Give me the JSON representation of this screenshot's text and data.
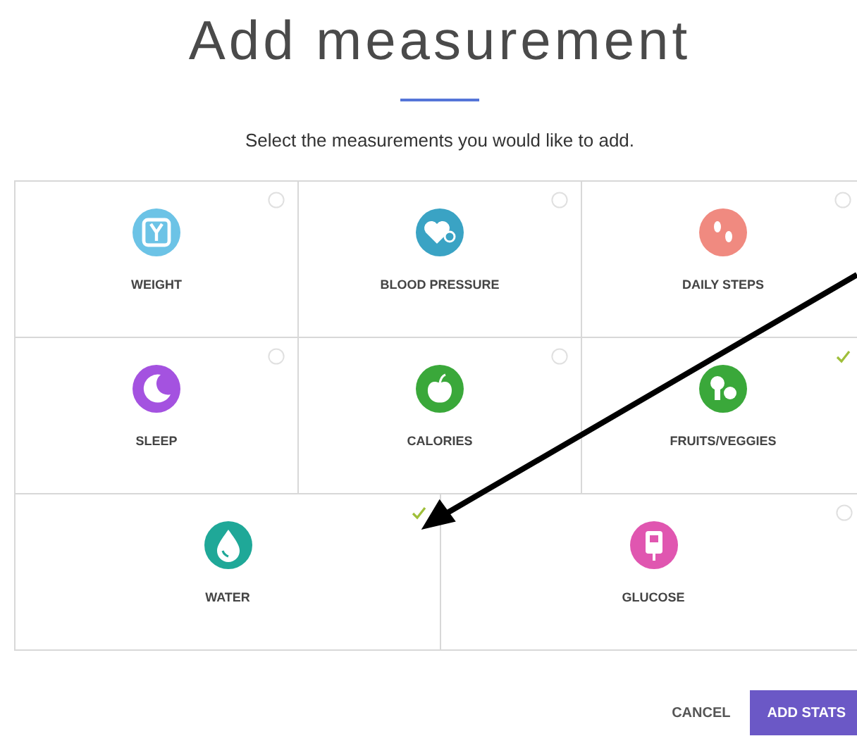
{
  "title": "Add measurement",
  "subtitle": "Select the measurements you would like to add.",
  "rows": [
    [
      {
        "label": "WEIGHT",
        "kind": "scale",
        "color": "#6cc3e6",
        "checked": false
      },
      {
        "label": "BLOOD PRESSURE",
        "kind": "heart",
        "color": "#3aa3c4",
        "checked": false
      },
      {
        "label": "DAILY STEPS",
        "kind": "steps",
        "color": "#f08a80",
        "checked": false
      }
    ],
    [
      {
        "label": "SLEEP",
        "kind": "moon",
        "color": "#a452e0",
        "checked": false
      },
      {
        "label": "CALORIES",
        "kind": "apple",
        "color": "#3aa83a",
        "checked": false
      },
      {
        "label": "FRUITS/VEGGIES",
        "kind": "broccoli",
        "color": "#3aa83a",
        "checked": true
      }
    ],
    [
      {
        "label": "WATER",
        "kind": "drop",
        "color": "#1fa898",
        "checked": true
      },
      {
        "label": "GLUCOSE",
        "kind": "meter",
        "color": "#e056b0",
        "checked": false
      }
    ]
  ],
  "buttons": [
    {
      "label": "CANCEL",
      "kind": "text"
    },
    {
      "label": "ADD STATS",
      "kind": "primary"
    }
  ]
}
